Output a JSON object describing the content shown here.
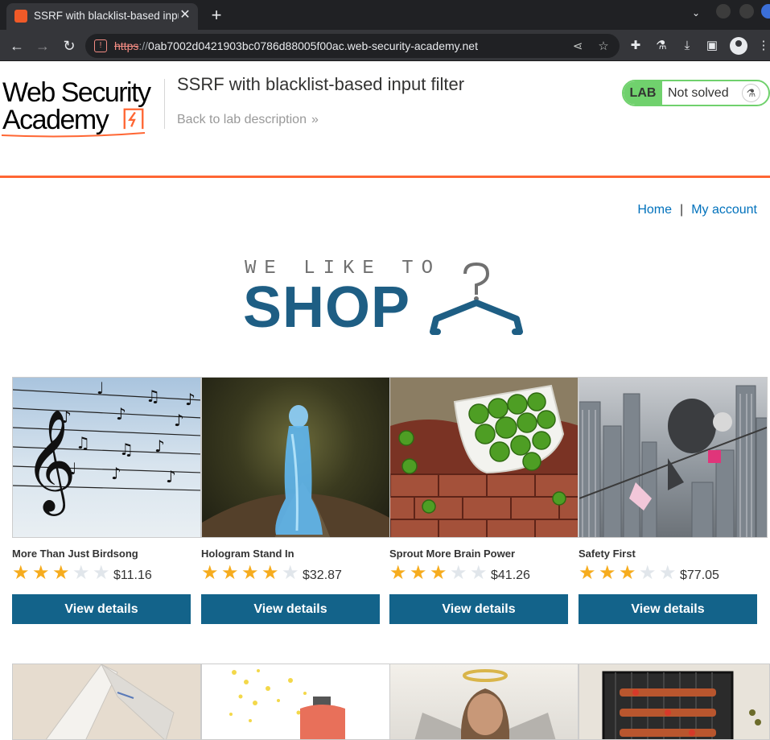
{
  "browser": {
    "tab_title": "SSRF with blacklist-based input filter",
    "url_scheme": "https",
    "url_separator": "://",
    "url_host": "0ab7002d0421903bc0786d88005f00ac.web-security-academy.net"
  },
  "academy": {
    "logo_line1": "Web Security",
    "logo_line2": "Academy",
    "lab_title": "SSRF with blacklist-based input filter",
    "back_link": "Back to lab description",
    "status_badge": "LAB",
    "status_text": "Not solved"
  },
  "nav": {
    "home": "Home",
    "separator": "|",
    "account": "My account"
  },
  "shop_logo": {
    "tagline": "WE LIKE TO",
    "word": "SHOP"
  },
  "products": [
    {
      "name": "More Than Just Birdsong",
      "rating": 3,
      "price": "$11.16",
      "button": "View details"
    },
    {
      "name": "Hologram Stand In",
      "rating": 4,
      "price": "$32.87",
      "button": "View details"
    },
    {
      "name": "Sprout More Brain Power",
      "rating": 3,
      "price": "$41.26",
      "button": "View details"
    },
    {
      "name": "Safety First",
      "rating": 3,
      "price": "$77.05",
      "button": "View details"
    }
  ],
  "colors": {
    "accent": "#ff6633",
    "button": "#13638a",
    "link": "#0071bc",
    "status_green": "#70d16d",
    "star_on": "#f6ac1e",
    "star_off": "#e1e6eb"
  }
}
